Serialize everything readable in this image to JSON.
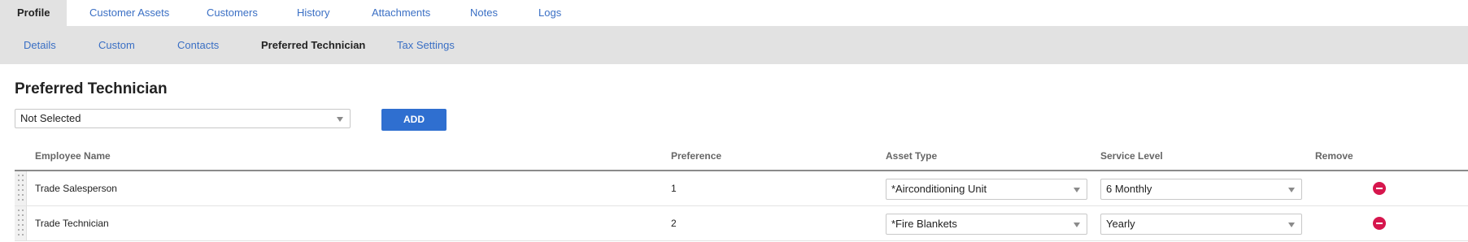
{
  "top_tabs": [
    "Profile",
    "Customer Assets",
    "Customers",
    "History",
    "Attachments",
    "Notes",
    "Logs"
  ],
  "sub_tabs": [
    "Details",
    "Custom",
    "Contacts",
    "Preferred Technician",
    "Tax Settings"
  ],
  "section_title": "Preferred Technician",
  "technician_select": {
    "value": "Not Selected"
  },
  "add_button": "ADD",
  "columns": {
    "employee": "Employee Name",
    "preference": "Preference",
    "asset_type": "Asset Type",
    "service_level": "Service Level",
    "remove": "Remove"
  },
  "rows": [
    {
      "employee": "Trade Salesperson",
      "preference": "1",
      "asset_type": "*Airconditioning Unit",
      "service_level": "6 Monthly"
    },
    {
      "employee": "Trade Technician",
      "preference": "2",
      "asset_type": "*Fire Blankets",
      "service_level": "Yearly"
    }
  ],
  "colors": {
    "accent": "#2f6fd0",
    "link": "#3a6fc4",
    "remove": "#d6164d",
    "bar": "#e2e2e2"
  }
}
